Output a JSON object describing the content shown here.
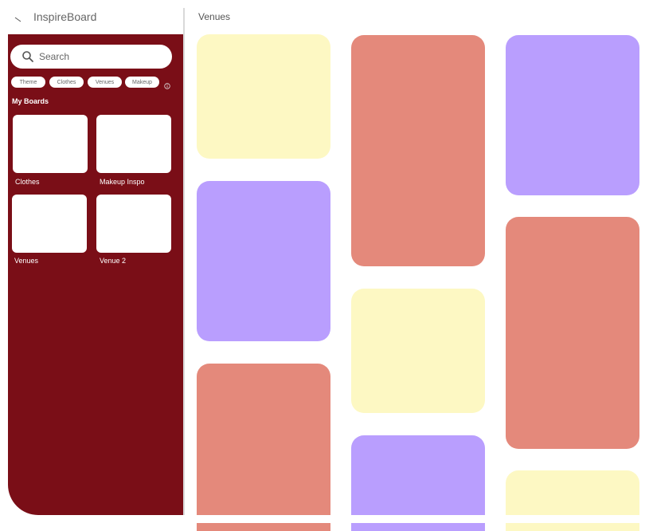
{
  "app": {
    "title": "InspireBoard"
  },
  "sidebar": {
    "search": {
      "placeholder": "Search"
    },
    "chips": [
      "Theme",
      "Clothes",
      "Venues",
      "Makeup"
    ],
    "section_title": "My Boards",
    "boards": [
      {
        "label": "Clothes"
      },
      {
        "label": "Makeup Inspo"
      },
      {
        "label": "Venues"
      },
      {
        "label": "Venue 2"
      }
    ]
  },
  "main": {
    "title": "Venues",
    "tiles": [
      {
        "color": "yellow",
        "hex": "#fdf8c3"
      },
      {
        "color": "purple",
        "hex": "#b99efe"
      },
      {
        "color": "salmon",
        "hex": "#e4897b"
      },
      {
        "color": "salmon",
        "hex": "#e4897b"
      },
      {
        "color": "yellow",
        "hex": "#fdf8c3"
      },
      {
        "color": "purple",
        "hex": "#b99efe"
      },
      {
        "color": "purple",
        "hex": "#b99efe"
      },
      {
        "color": "salmon",
        "hex": "#e4897b"
      },
      {
        "color": "yellow",
        "hex": "#fdf8c3"
      }
    ]
  },
  "colors": {
    "sidebar_bg": "#7a0e17",
    "yellow": "#fdf8c3",
    "salmon": "#e4897b",
    "purple": "#b99efe"
  },
  "icons": {
    "header": "back-arrow-icon",
    "search": "search-icon",
    "info": "info-icon"
  }
}
